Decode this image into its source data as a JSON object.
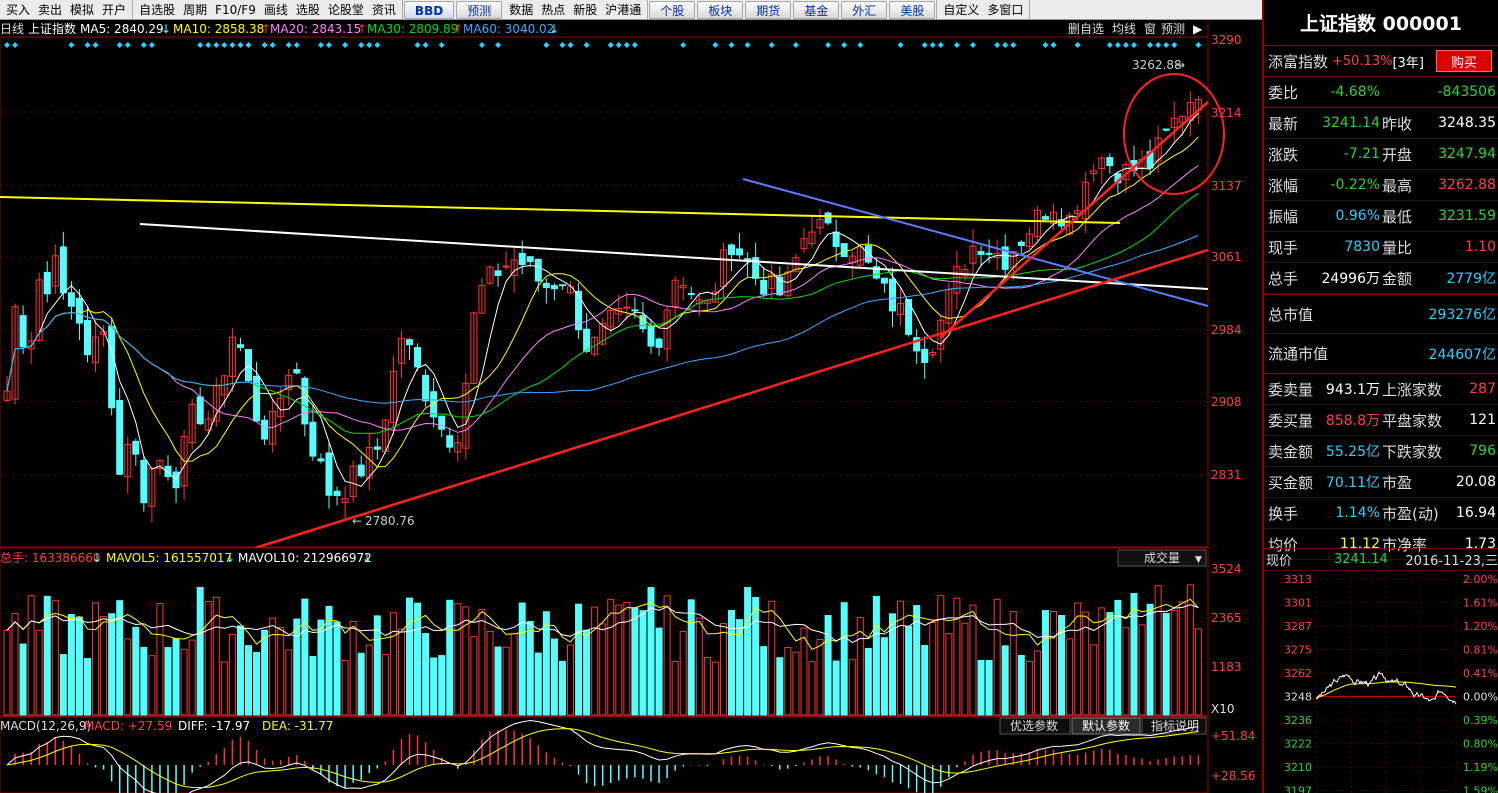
{
  "toolbar": {
    "group1": [
      "买入",
      "卖出",
      "模拟",
      "开户"
    ],
    "group2": [
      "自选股",
      "周期",
      "F10/F9",
      "画线",
      "选股",
      "论股堂",
      "资讯"
    ],
    "bbd": "BBD",
    "forecast": "预测",
    "group3": [
      "数据",
      "热点",
      "新股",
      "沪港通"
    ],
    "tabs": [
      "个股",
      "板块",
      "期货",
      "基金",
      "外汇",
      "美股"
    ],
    "group4": [
      "自定义",
      "多窗口"
    ]
  },
  "chart_header": {
    "period": "日线",
    "name": "上证指数",
    "ma5": "MA5: 2840.29",
    "ma10": "MA10: 2858.38",
    "ma20": "MA20: 2843.15",
    "ma30": "MA30: 2809.89",
    "ma60": "MA60: 3040.02",
    "right_buttons": [
      "删自选",
      "均线",
      "窗",
      "预测"
    ]
  },
  "price_axis": [
    "3290",
    "3214",
    "3137",
    "3061",
    "2984",
    "2908",
    "2831"
  ],
  "annotations": {
    "high": "3262.88",
    "low": "2780.76"
  },
  "volume_header": {
    "total": "总手: 163386660",
    "mavol5": "MAVOL5: 161557017",
    "mavol10": "MAVOL10: 212966972",
    "dropdown": "成交量"
  },
  "volume_axis": [
    "3524",
    "2365",
    "1183",
    "X10"
  ],
  "macd_header": {
    "params": "MACD(12,26,9)",
    "macd": "MACD: +27.59",
    "diff": "DIFF: -17.97",
    "dea": "DEA: -31.77",
    "buttons": [
      "优选参数",
      "默认参数",
      "指标说明"
    ]
  },
  "macd_axis": [
    "+51.84",
    "+28.56"
  ],
  "panel": {
    "title": "上证指数 000001",
    "tianfu": {
      "label": "添富指数",
      "value": "+50.13%",
      "period": "[3年]",
      "buy": "购买"
    },
    "weibi": {
      "label": "委比",
      "v1": "-4.68%",
      "v2": "-843506"
    },
    "rows": [
      {
        "l1": "最新",
        "v1": "3241.14",
        "c1": "green",
        "l2": "昨收",
        "v2": "3248.35",
        "c2": "white"
      },
      {
        "l1": "涨跌",
        "v1": "-7.21",
        "c1": "green",
        "l2": "开盘",
        "v2": "3247.94",
        "c2": "green"
      },
      {
        "l1": "涨幅",
        "v1": "-0.22%",
        "c1": "green",
        "l2": "最高",
        "v2": "3262.88",
        "c2": "red"
      },
      {
        "l1": "振幅",
        "v1": "0.96%",
        "c1": "cyan",
        "l2": "最低",
        "v2": "3231.59",
        "c2": "green"
      },
      {
        "l1": "现手",
        "v1": "7830",
        "c1": "cyan",
        "l2": "量比",
        "v2": "1.10",
        "c2": "red"
      },
      {
        "l1": "总手",
        "v1": "24996万",
        "c1": "white",
        "l2": "金额",
        "v2": "2779亿",
        "c2": "cyan"
      }
    ],
    "market_cap": {
      "label": "总市值",
      "value": "293276亿"
    },
    "float_cap": {
      "label": "流通市值",
      "value": "244607亿"
    },
    "rows2": [
      {
        "l1": "委卖量",
        "v1": "943.1万",
        "c1": "white",
        "l2": "上涨家数",
        "v2": "287",
        "c2": "red"
      },
      {
        "l1": "委买量",
        "v1": "858.8万",
        "c1": "red",
        "l2": "平盘家数",
        "v2": "121",
        "c2": "white"
      },
      {
        "l1": "卖金额",
        "v1": "55.25亿",
        "c1": "cyan",
        "l2": "下跌家数",
        "v2": "796",
        "c2": "green"
      },
      {
        "l1": "买金额",
        "v1": "70.11亿",
        "c1": "cyan",
        "l2": "市盈",
        "v2": "20.08",
        "c2": "white"
      },
      {
        "l1": "换手",
        "v1": "1.14%",
        "c1": "cyan",
        "l2": "市盈(动)",
        "v2": "16.94",
        "c2": "white"
      },
      {
        "l1": "均价",
        "v1": "11.12",
        "c1": "yellow",
        "l2": "市净率",
        "v2": "1.73",
        "c2": "white"
      }
    ],
    "mini": {
      "now_label": "现价",
      "now_value": "3241.14",
      "date": "2016-11-23,三",
      "left_axis": [
        "3313",
        "3301",
        "3287",
        "3275",
        "3262",
        "3248",
        "3236",
        "3222",
        "3210",
        "3197"
      ],
      "right_axis": [
        "2.00%",
        "1.61%",
        "1.20%",
        "0.81%",
        "0.41%",
        "0.00%",
        "0.39%",
        "0.80%",
        "1.19%",
        "1.59%"
      ]
    }
  },
  "colors": {
    "up": "#ff3232",
    "down": "#54ffff",
    "ma5": "#ffffff",
    "ma10": "#ffff00",
    "ma20": "#ff80ff",
    "ma30": "#00e000",
    "ma60": "#3fa9ff"
  }
}
